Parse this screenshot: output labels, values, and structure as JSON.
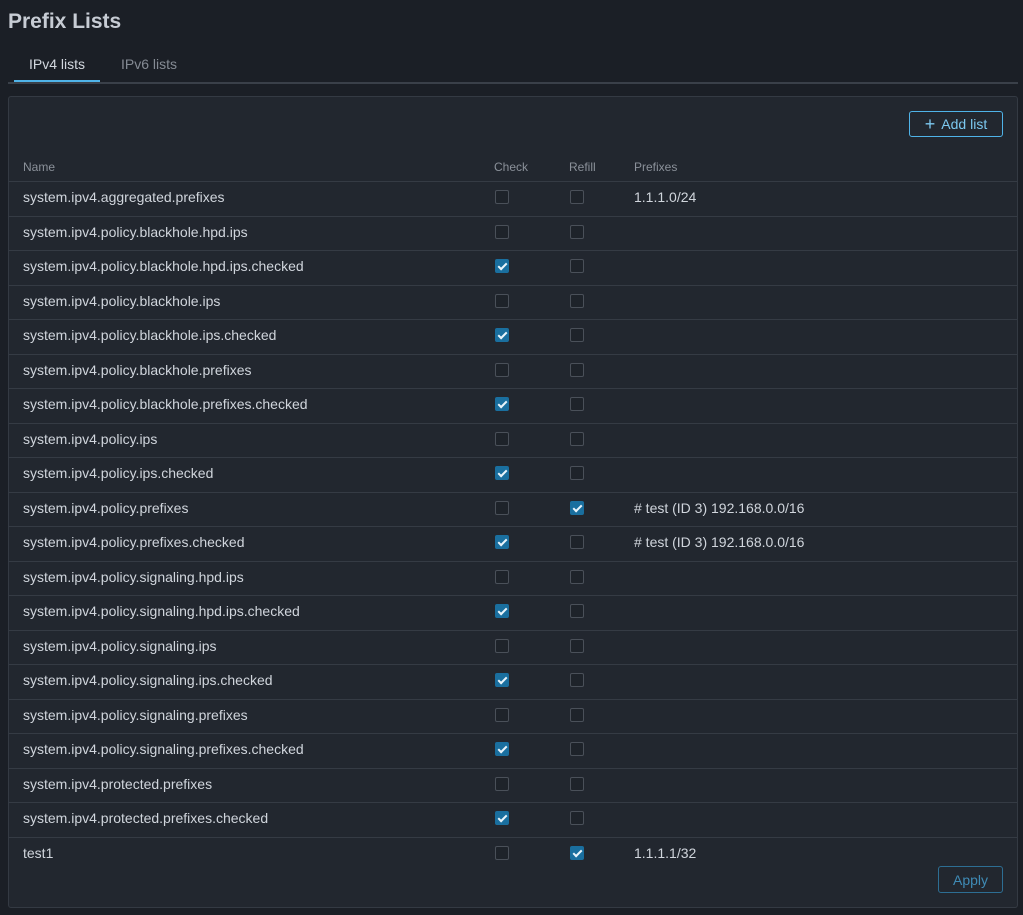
{
  "page": {
    "title": "Prefix Lists"
  },
  "tabs": [
    {
      "label": "IPv4 lists",
      "active": true
    },
    {
      "label": "IPv6 lists",
      "active": false
    }
  ],
  "toolbar": {
    "add_label": "Add list",
    "add_icon": "plus-icon"
  },
  "table": {
    "columns": {
      "name": "Name",
      "check": "Check",
      "refill": "Refill",
      "prefixes": "Prefixes"
    },
    "rows": [
      {
        "name": "system.ipv4.aggregated.prefixes",
        "check": false,
        "refill": false,
        "prefixes": "1.1.1.0/24"
      },
      {
        "name": "system.ipv4.policy.blackhole.hpd.ips",
        "check": false,
        "refill": false,
        "prefixes": ""
      },
      {
        "name": "system.ipv4.policy.blackhole.hpd.ips.checked",
        "check": true,
        "refill": false,
        "prefixes": ""
      },
      {
        "name": "system.ipv4.policy.blackhole.ips",
        "check": false,
        "refill": false,
        "prefixes": ""
      },
      {
        "name": "system.ipv4.policy.blackhole.ips.checked",
        "check": true,
        "refill": false,
        "prefixes": ""
      },
      {
        "name": "system.ipv4.policy.blackhole.prefixes",
        "check": false,
        "refill": false,
        "prefixes": ""
      },
      {
        "name": "system.ipv4.policy.blackhole.prefixes.checked",
        "check": true,
        "refill": false,
        "prefixes": ""
      },
      {
        "name": "system.ipv4.policy.ips",
        "check": false,
        "refill": false,
        "prefixes": ""
      },
      {
        "name": "system.ipv4.policy.ips.checked",
        "check": true,
        "refill": false,
        "prefixes": ""
      },
      {
        "name": "system.ipv4.policy.prefixes",
        "check": false,
        "refill": true,
        "prefixes": "# test (ID 3) 192.168.0.0/16"
      },
      {
        "name": "system.ipv4.policy.prefixes.checked",
        "check": true,
        "refill": false,
        "prefixes": "# test (ID 3) 192.168.0.0/16"
      },
      {
        "name": "system.ipv4.policy.signaling.hpd.ips",
        "check": false,
        "refill": false,
        "prefixes": ""
      },
      {
        "name": "system.ipv4.policy.signaling.hpd.ips.checked",
        "check": true,
        "refill": false,
        "prefixes": ""
      },
      {
        "name": "system.ipv4.policy.signaling.ips",
        "check": false,
        "refill": false,
        "prefixes": ""
      },
      {
        "name": "system.ipv4.policy.signaling.ips.checked",
        "check": true,
        "refill": false,
        "prefixes": ""
      },
      {
        "name": "system.ipv4.policy.signaling.prefixes",
        "check": false,
        "refill": false,
        "prefixes": ""
      },
      {
        "name": "system.ipv4.policy.signaling.prefixes.checked",
        "check": true,
        "refill": false,
        "prefixes": ""
      },
      {
        "name": "system.ipv4.protected.prefixes",
        "check": false,
        "refill": false,
        "prefixes": ""
      },
      {
        "name": "system.ipv4.protected.prefixes.checked",
        "check": true,
        "refill": false,
        "prefixes": ""
      },
      {
        "name": "test1",
        "check": false,
        "refill": true,
        "prefixes": "1.1.1.1/32"
      }
    ]
  },
  "footer": {
    "apply_label": "Apply"
  },
  "colors": {
    "accent": "#4fb3e8",
    "checkbox_checked": "#1a6f9f",
    "background": "#1b1f26",
    "panel": "#22272f"
  }
}
